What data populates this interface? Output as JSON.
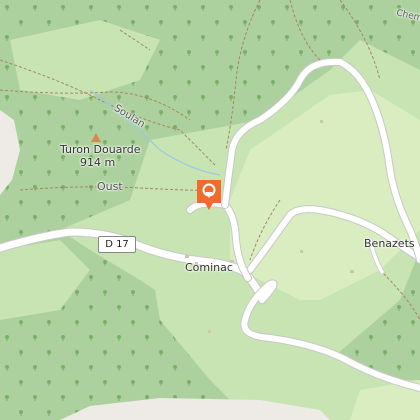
{
  "map": {
    "colors": {
      "forest": "#add19e",
      "meadow": "#c8e4b3",
      "grass": "#d9edc0",
      "road": "#ffffff",
      "rock": "#eeeae5",
      "marker": "#f26b2e"
    },
    "labels": {
      "peak_name": "Turon Douarde",
      "peak_elevation": "914 m",
      "stream": "Soulan",
      "river": "Oust",
      "road_ref": "D 17",
      "village_1": "Cominac",
      "village_2": "Benazets",
      "corner_label": "Chem"
    },
    "marker_icon": "location-pin-icon",
    "peak_icon": "peak-triangle-icon",
    "tree_icon": "tree-icon"
  }
}
